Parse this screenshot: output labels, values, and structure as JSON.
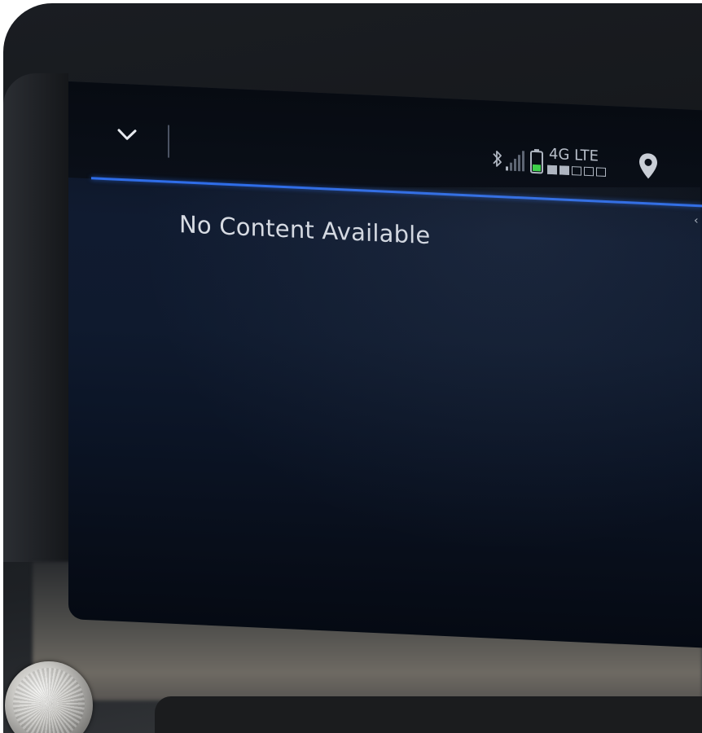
{
  "screen": {
    "message": "No Content Available"
  },
  "status_bar": {
    "network_label": "4G LTE",
    "network_strength_filled": 2,
    "network_strength_total": 5,
    "battery_level_color": "#3fd04b",
    "accent_line_color": "#2f6de8",
    "icons": {
      "collapse": "chevron-down-icon",
      "bluetooth": "bluetooth-icon",
      "signal": "signal-strength-icon",
      "battery": "battery-icon",
      "location": "location-pin-icon"
    }
  }
}
